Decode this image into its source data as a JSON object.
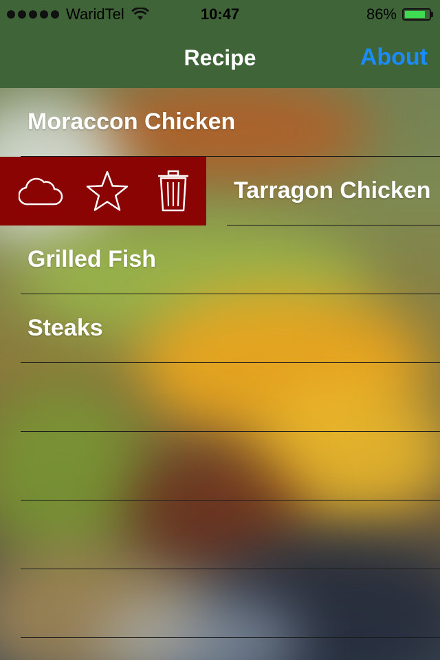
{
  "status_bar": {
    "carrier": "WaridTel",
    "time": "10:47",
    "battery_percent": "86%",
    "battery_level": 0.86,
    "signal_bars": 5
  },
  "nav": {
    "title": "Recipe",
    "about_label": "About"
  },
  "recipes": [
    {
      "name": "Moraccon Chicken"
    },
    {
      "name": "Tarragon Chicken"
    },
    {
      "name": "Grilled Fish"
    },
    {
      "name": "Steaks"
    }
  ],
  "swipe_actions": {
    "icons": [
      "cloud-icon",
      "star-icon",
      "trash-icon"
    ],
    "color": "#8a0404"
  },
  "colors": {
    "nav_bar": "#3f6437",
    "accent": "#1a8cff",
    "battery_fill": "#3ddc52"
  }
}
